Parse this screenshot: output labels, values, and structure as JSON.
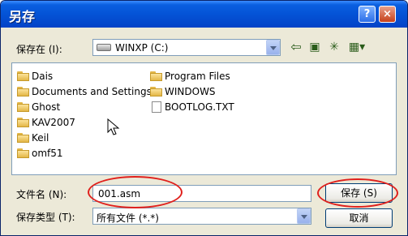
{
  "window": {
    "title": "另存",
    "help_label": "?",
    "close_label": "×"
  },
  "save_in": {
    "label": "保存在 (I):",
    "value": "WINXP (C:)"
  },
  "files": [
    {
      "name": "Dais",
      "type": "folder"
    },
    {
      "name": "Documents and Settings",
      "type": "folder"
    },
    {
      "name": "Ghost",
      "type": "folder"
    },
    {
      "name": "KAV2007",
      "type": "folder"
    },
    {
      "name": "Keil",
      "type": "folder"
    },
    {
      "name": "omf51",
      "type": "folder"
    },
    {
      "name": "Program Files",
      "type": "folder"
    },
    {
      "name": "WINDOWS",
      "type": "folder"
    },
    {
      "name": "BOOTLOG.TXT",
      "type": "file"
    }
  ],
  "filename": {
    "label": "文件名 (N):",
    "value": "001.asm"
  },
  "filetype": {
    "label": "保存类型 (T):",
    "value": "所有文件 (*.*)"
  },
  "buttons": {
    "save": "保存 (S)",
    "cancel": "取消"
  },
  "colors": {
    "annotation": "#e0201c",
    "titlebar": "#0453d6"
  }
}
